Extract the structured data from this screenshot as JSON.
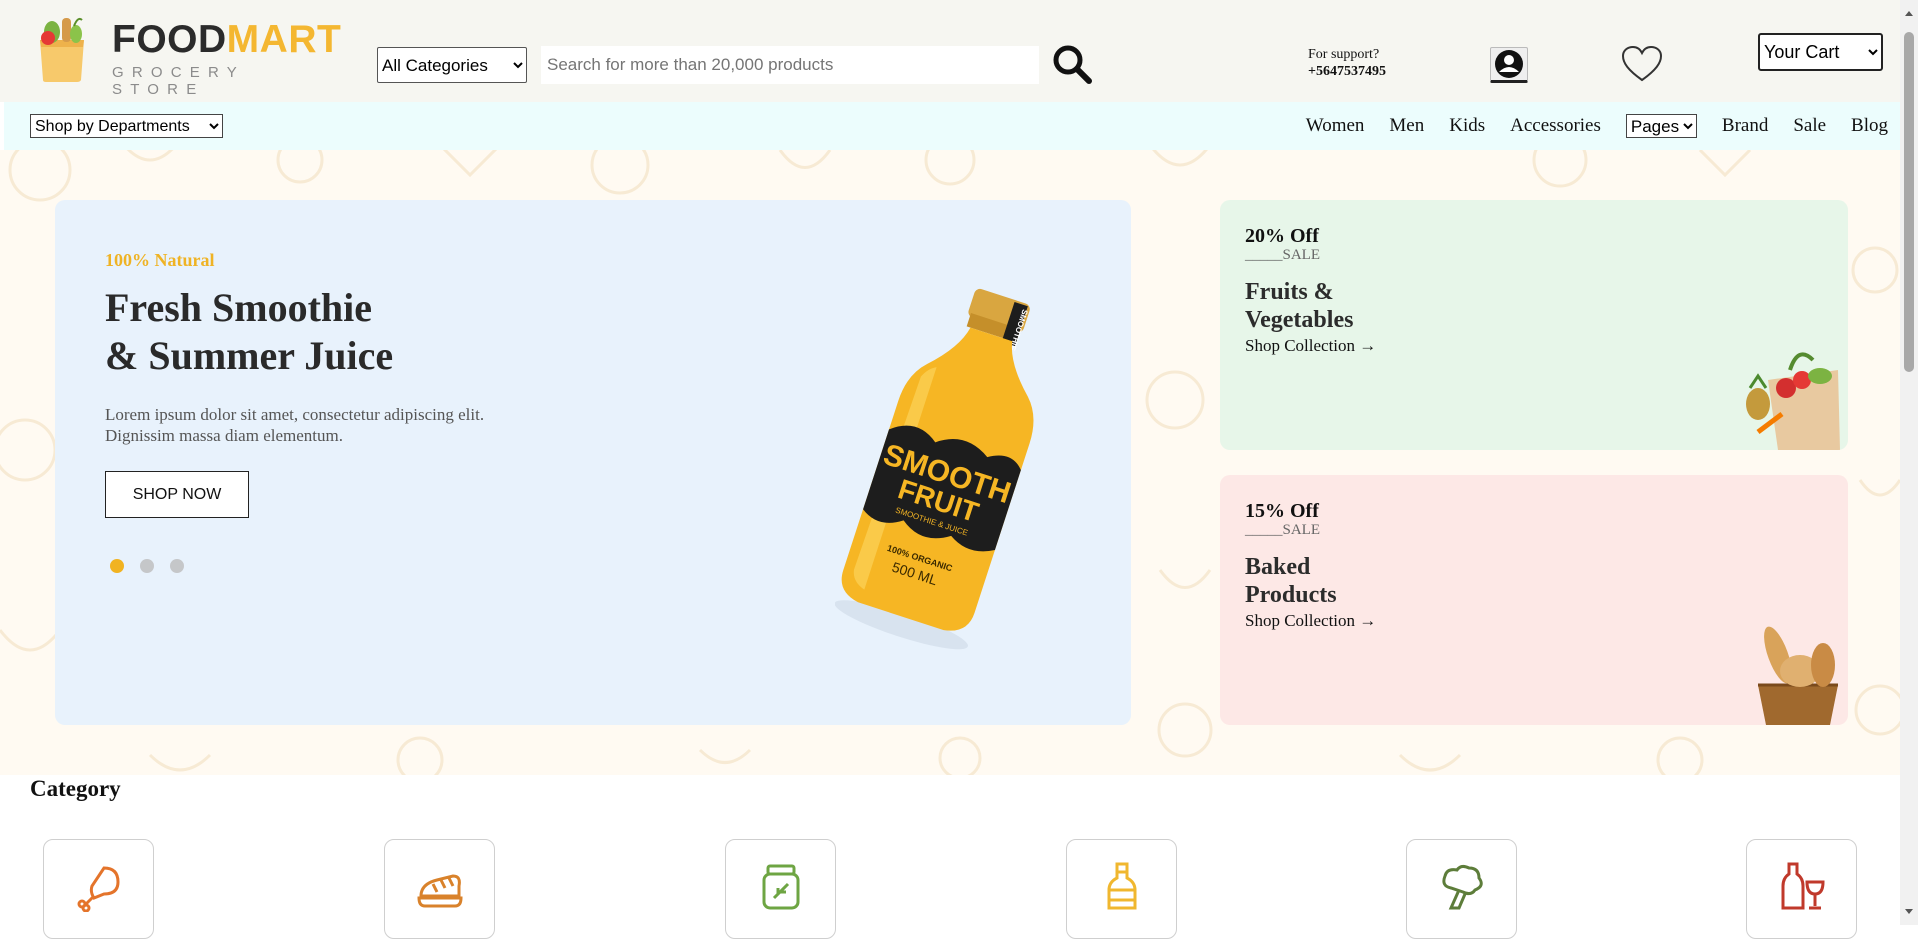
{
  "header": {
    "logo": {
      "brand_part1": "FOOD",
      "brand_part2": "MART",
      "tagline": "GROCERY STORE"
    },
    "category_select": {
      "selected": "All Categories",
      "options": [
        "All Categories"
      ]
    },
    "search": {
      "placeholder": "Search for more than 20,000 products"
    },
    "support": {
      "label": "For support?",
      "phone": "+5647537495"
    },
    "cart_select": {
      "selected": "Your Cart",
      "options": [
        "Your Cart"
      ]
    }
  },
  "nav": {
    "departments": {
      "selected": "Shop by Departments",
      "options": [
        "Shop by Departments"
      ]
    },
    "links": {
      "women": "Women",
      "men": "Men",
      "kids": "Kids",
      "accessories": "Accessories",
      "brand": "Brand",
      "sale": "Sale",
      "blog": "Blog"
    },
    "pages_select": {
      "selected": "Pages",
      "options": [
        "Pages"
      ]
    }
  },
  "hero": {
    "kicker": "100% Natural",
    "title_line1": "Fresh Smoothie",
    "title_line2": "& Summer Juice",
    "text_line1": "Lorem ipsum dolor sit amet, consectetur adipiscing elit.",
    "text_line2": "Dignissim massa diam elementum.",
    "button": "SHOP NOW",
    "slides": 3,
    "active_slide": 1,
    "product": {
      "brand_line1": "SMOOTH",
      "brand_line2": "FRUIT",
      "sub": "SMOOTHIE & JUICE",
      "organic": "100% ORGANIC",
      "volume": "500 ML",
      "cap_label": "SMOOTHIE"
    }
  },
  "promos": [
    {
      "discount": "20% Off",
      "sale": "_____SALE",
      "title_line1": "Fruits &",
      "title_line2": "Vegetables",
      "link": "Shop Collection →",
      "bg": "#e7f6e9"
    },
    {
      "discount": "15% Off",
      "sale": "_____SALE",
      "title_line1": "Baked",
      "title_line2": "Products",
      "link": "Shop Collection →",
      "bg": "#fde8e6"
    }
  ],
  "category": {
    "heading": "Category",
    "items": [
      {
        "icon": "chicken-leg-icon",
        "color": "#e4742b"
      },
      {
        "icon": "bread-icon",
        "color": "#d9822b"
      },
      {
        "icon": "jar-icon",
        "color": "#6ea543"
      },
      {
        "icon": "bottle-icon",
        "color": "#f0b72f"
      },
      {
        "icon": "broccoli-icon",
        "color": "#5d7d3a"
      },
      {
        "icon": "wine-icon",
        "color": "#c0392b"
      }
    ]
  },
  "colors": {
    "accent": "#f4b731",
    "header_bg": "#f6f6f1",
    "nav_bg": "#ecfdfd",
    "banner_bg": "#e8f2fc"
  }
}
